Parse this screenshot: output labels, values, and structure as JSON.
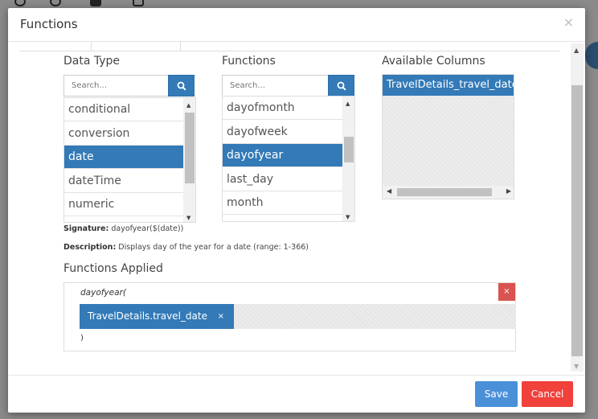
{
  "modal": {
    "title": "Functions",
    "close": "×"
  },
  "data_type": {
    "label": "Data Type",
    "search_placeholder": "Search...",
    "items": [
      {
        "label": "conditional",
        "active": false
      },
      {
        "label": "conversion",
        "active": false
      },
      {
        "label": "date",
        "active": true
      },
      {
        "label": "dateTime",
        "active": false
      },
      {
        "label": "numeric",
        "active": false
      }
    ]
  },
  "functions": {
    "label": "Functions",
    "search_placeholder": "Search...",
    "items": [
      {
        "label": "dayofmonth",
        "active": false
      },
      {
        "label": "dayofweek",
        "active": false
      },
      {
        "label": "dayofyear",
        "active": true
      },
      {
        "label": "last_day",
        "active": false
      },
      {
        "label": "month",
        "active": false
      }
    ]
  },
  "available_columns": {
    "label": "Available Columns",
    "items": [
      "TravelDetails_travel_date"
    ]
  },
  "signature": {
    "label": "Signature:",
    "value": "dayofyear($(date))"
  },
  "description": {
    "label": "Description:",
    "value": "Displays day of the year for a date (range: 1-366)"
  },
  "applied": {
    "label": "Functions Applied",
    "function_name": "dayofyear(",
    "remove": "×",
    "argument": "TravelDetails.travel_date",
    "argument_remove": "×",
    "close_paren": ")"
  },
  "footer": {
    "save": "Save",
    "cancel": "Cancel"
  },
  "colors": {
    "primary": "#337ab7",
    "danger": "#d9534f",
    "cancel": "#f0413b",
    "save": "#4a90d9"
  }
}
